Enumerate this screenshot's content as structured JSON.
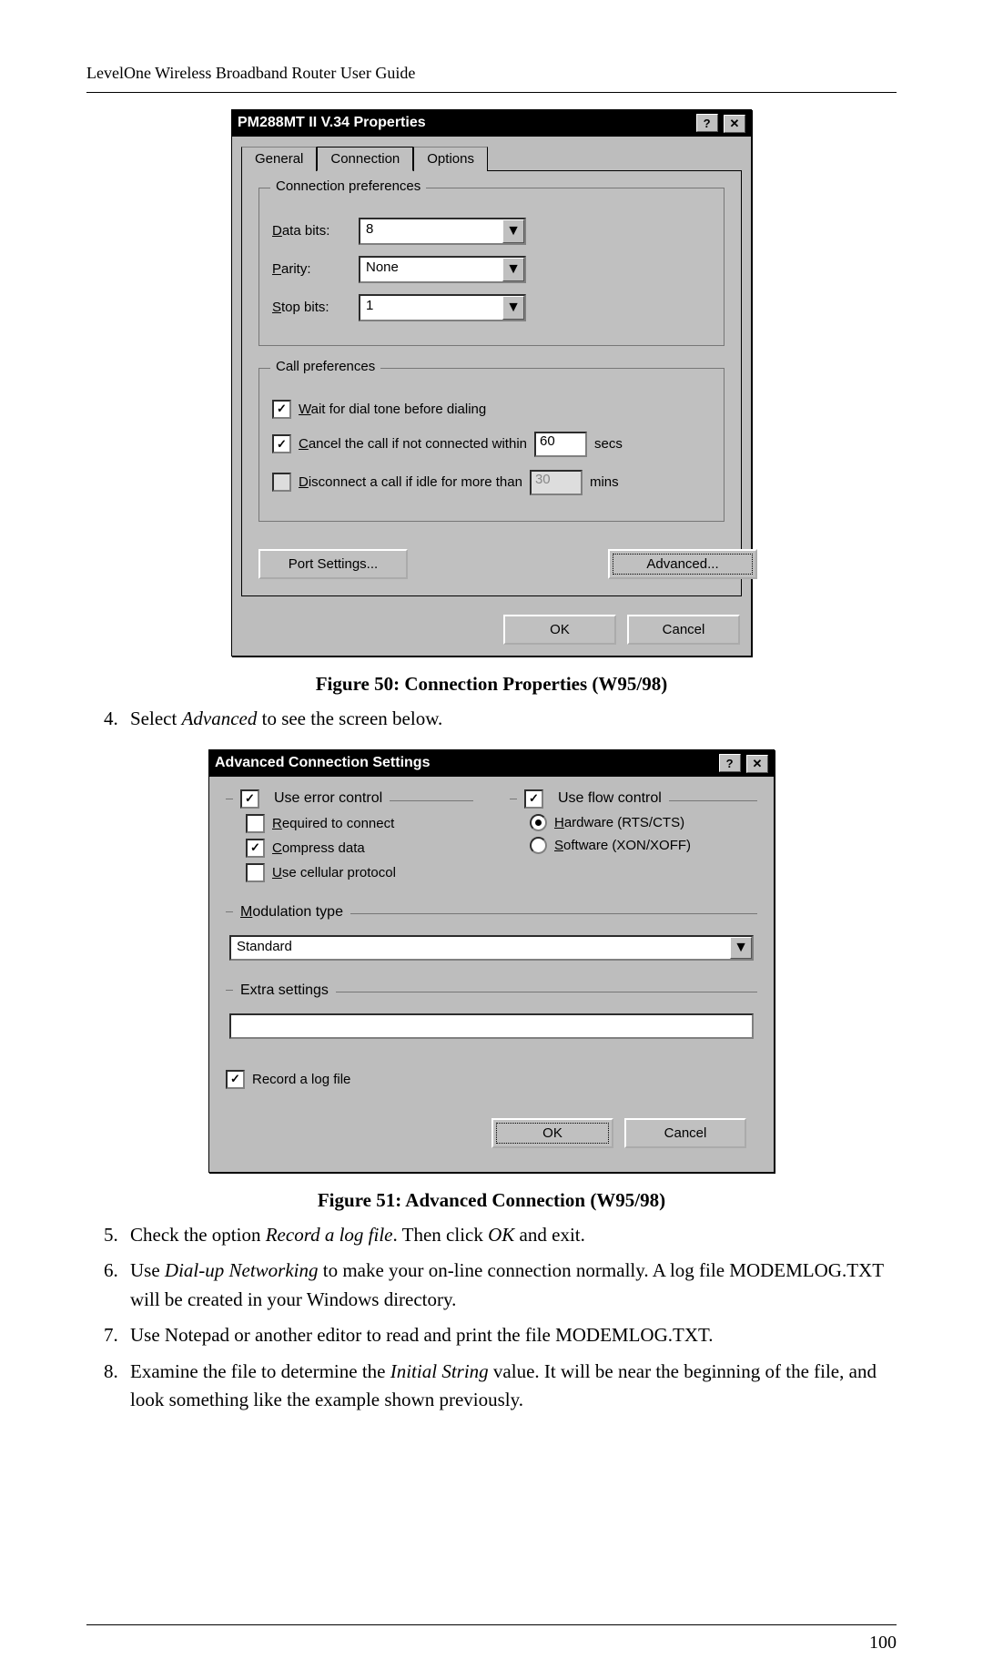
{
  "header": "LevelOne Wireless Broadband Router User Guide",
  "page_number": "100",
  "caption1": "Figure 50: Connection Properties (W95/98)",
  "caption2": "Figure 51: Advanced Connection (W95/98)",
  "step4_pre": "Select ",
  "step4_em": "Advanced",
  "step4_post": " to see the screen below.",
  "step5_pre": "Check the option ",
  "step5_em": "Record a log file",
  "step5_mid": ". Then click ",
  "step5_em2": "OK",
  "step5_post": " and exit.",
  "step6_pre": "Use ",
  "step6_em": "Dial-up Networking",
  "step6_post": " to make your on-line connection normally. A log file MODEMLOG.TXT will be created in your Windows directory.",
  "step7": "Use Notepad or another editor to read and print the file MODEMLOG.TXT.",
  "step8_pre": "Examine the file to determine the ",
  "step8_em": "Initial String",
  "step8_post": " value. It will be near the beginning of the file, and look something like the example shown previously.",
  "dlg1": {
    "title": "PM288MT II V.34 Properties",
    "help_glyph": "?",
    "close_glyph": "✕",
    "tabs": {
      "general": "General",
      "connection": "Connection",
      "options": "Options"
    },
    "grp_conn_pref": "Connection preferences",
    "data_bits_label": "Data bits:",
    "data_bits_value": "8",
    "parity_label": "Parity:",
    "parity_value": "None",
    "stop_bits_label": "Stop bits:",
    "stop_bits_value": "1",
    "grp_call_pref": "Call preferences",
    "wait_label": "Wait for dial tone before dialing",
    "cancel_label": "Cancel the call if not connected within",
    "cancel_value": "60",
    "cancel_unit": "secs",
    "disconnect_label": "Disconnect a call if idle for more than",
    "disconnect_value": "30",
    "disconnect_unit": "mins",
    "port_settings": "Port Settings...",
    "advanced": "Advanced...",
    "ok": "OK",
    "cancel": "Cancel",
    "dropdown_glyph": "▼",
    "check_glyph": "✓"
  },
  "dlg2": {
    "title": "Advanced Connection Settings",
    "help_glyph": "?",
    "close_glyph": "✕",
    "use_error": "Use error control",
    "required": "Required to connect",
    "compress": "Compress data",
    "cellular": "Use cellular protocol",
    "use_flow": "Use flow control",
    "hardware": "Hardware (RTS/CTS)",
    "software": "Software (XON/XOFF)",
    "modulation": "Modulation type",
    "modulation_value": "Standard",
    "extra": "Extra settings",
    "extra_value": "",
    "record": "Record a log file",
    "ok": "OK",
    "cancel": "Cancel",
    "dropdown_glyph": "▼",
    "check_glyph": "✓"
  }
}
